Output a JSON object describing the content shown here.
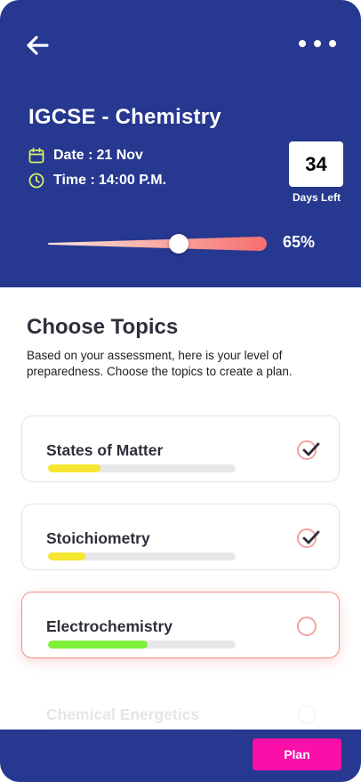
{
  "header": {
    "title": "IGCSE - Chemistry",
    "date_label": "Date :",
    "date_value": "21 Nov",
    "time_label": "Time :",
    "time_value": "14:00 P.M.",
    "days_left_value": "34",
    "days_left_label": "Days Left",
    "preparedness_percent_text": "65%",
    "preparedness_fraction": 0.6,
    "icons": {
      "back": "arrow-left-icon",
      "menu": "more-horizontal-icon",
      "date": "calendar-icon",
      "time": "clock-icon"
    }
  },
  "topics_section": {
    "title": "Choose Topics",
    "description": "Based on your assessment, here is your level of preparedness. Choose the topics to create a plan.",
    "topics": [
      {
        "name": "States of Matter",
        "progress": 0.28,
        "bar_color": "#f5e631",
        "checked": true,
        "selected": false,
        "faded": false
      },
      {
        "name": "Stoichiometry",
        "progress": 0.2,
        "bar_color": "#f5e631",
        "checked": true,
        "selected": false,
        "faded": false
      },
      {
        "name": "Electrochemistry",
        "progress": 0.53,
        "bar_color": "#7ef03a",
        "checked": false,
        "selected": true,
        "faded": false
      },
      {
        "name": "Chemical Energetics",
        "progress": 0.0,
        "bar_color": "#e8e8ea",
        "checked": false,
        "selected": false,
        "faded": true
      }
    ]
  },
  "footer": {
    "plan_label": "Plan"
  },
  "colors": {
    "primary": "#26388f",
    "accent": "#fa0fa9",
    "slider_light": "#fcd0cb",
    "slider_dark": "#f56f6f",
    "check_ring": "#f2a3a3"
  }
}
